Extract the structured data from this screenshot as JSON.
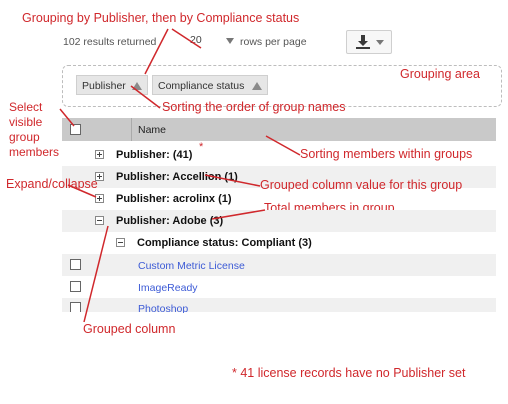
{
  "annotations": {
    "grouping_title": "Grouping by Publisher, then by Compliance status",
    "grouping_area": "Grouping area",
    "select_visible": [
      "Select",
      "visible",
      "group",
      "members"
    ],
    "sorting_group_names": "Sorting the order of group names",
    "sorting_members": "Sorting members within groups",
    "expand_collapse": "Expand/collapse",
    "grouped_value": "Grouped column value for this group",
    "total_members": "Total members in group",
    "grouped_column": "Grouped column",
    "asterisk": "*",
    "footnote": "* 41 license records have no Publisher set"
  },
  "toolbar": {
    "results": "102 results returned",
    "page_size": "20",
    "rows_per_page": "rows per page",
    "download_icon": "download-icon"
  },
  "grouping": {
    "chips": [
      "Publisher",
      "Compliance status"
    ]
  },
  "grid": {
    "column_header": "Name",
    "groups": [
      {
        "label": "Publisher: (41)",
        "expanded": false
      },
      {
        "label": "Publisher: Accellion (1)",
        "expanded": false
      },
      {
        "label": "Publisher: acrolinx (1)",
        "expanded": false
      },
      {
        "label": "Publisher: Adobe (3)",
        "expanded": true
      }
    ],
    "subgroup": {
      "label": "Compliance status: Compliant (3)",
      "expanded": true
    },
    "rows": [
      "Custom Metric License",
      "ImageReady",
      "Photoshop"
    ]
  },
  "colors": {
    "annotation": "#d0282c",
    "link": "#3d5bd6",
    "header_bg": "#c9c9c9"
  }
}
